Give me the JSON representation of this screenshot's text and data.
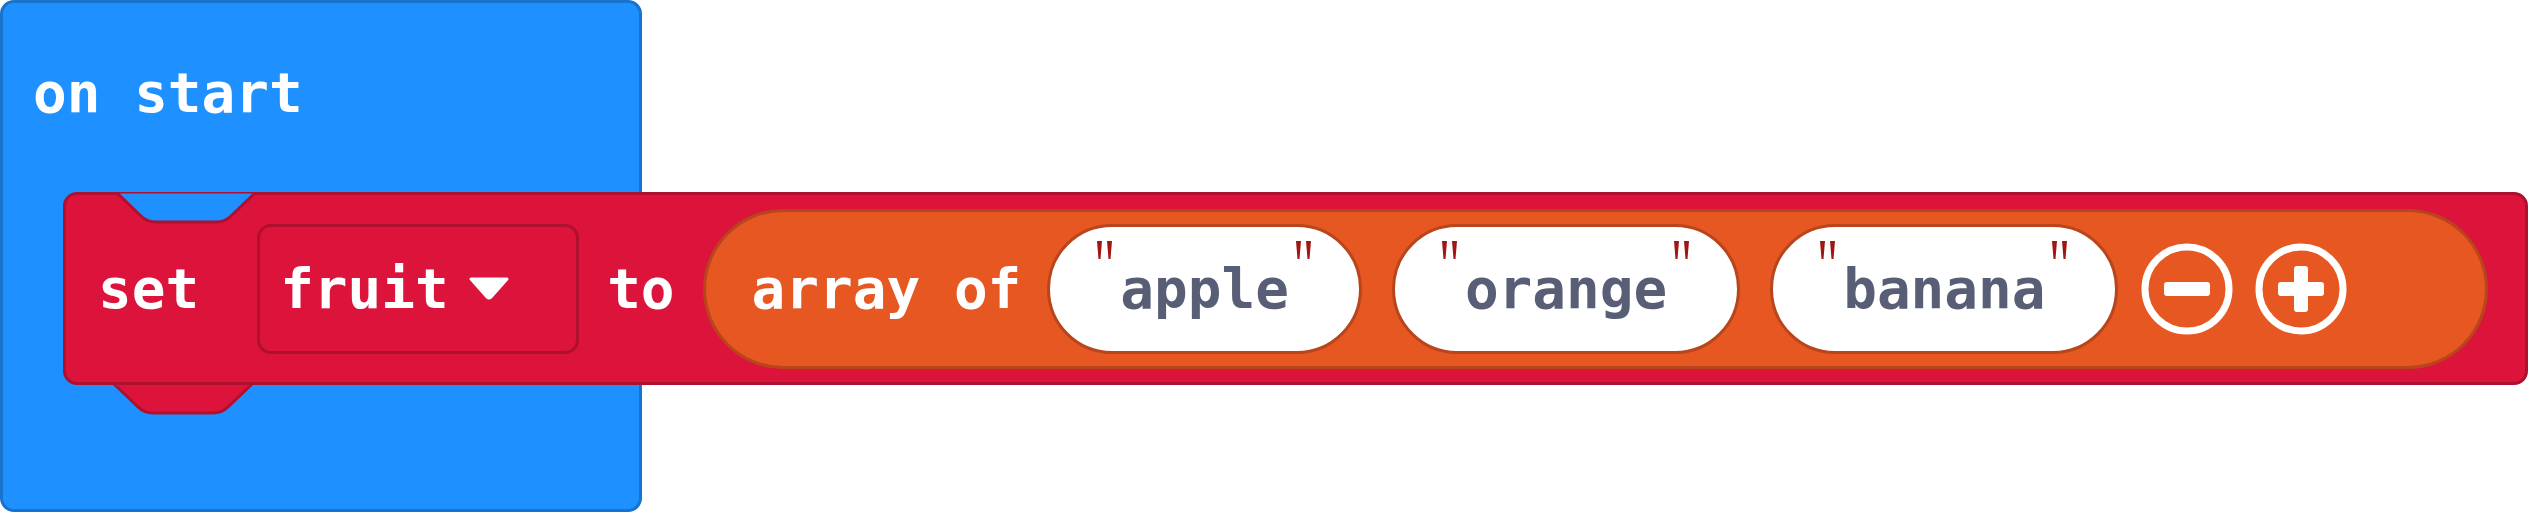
{
  "event_block": {
    "label": "on start"
  },
  "statement": {
    "keyword": "set",
    "variable": "fruit",
    "connector": "to",
    "value": {
      "label": "array of",
      "items": [
        "apple",
        "orange",
        "banana"
      ]
    }
  }
}
